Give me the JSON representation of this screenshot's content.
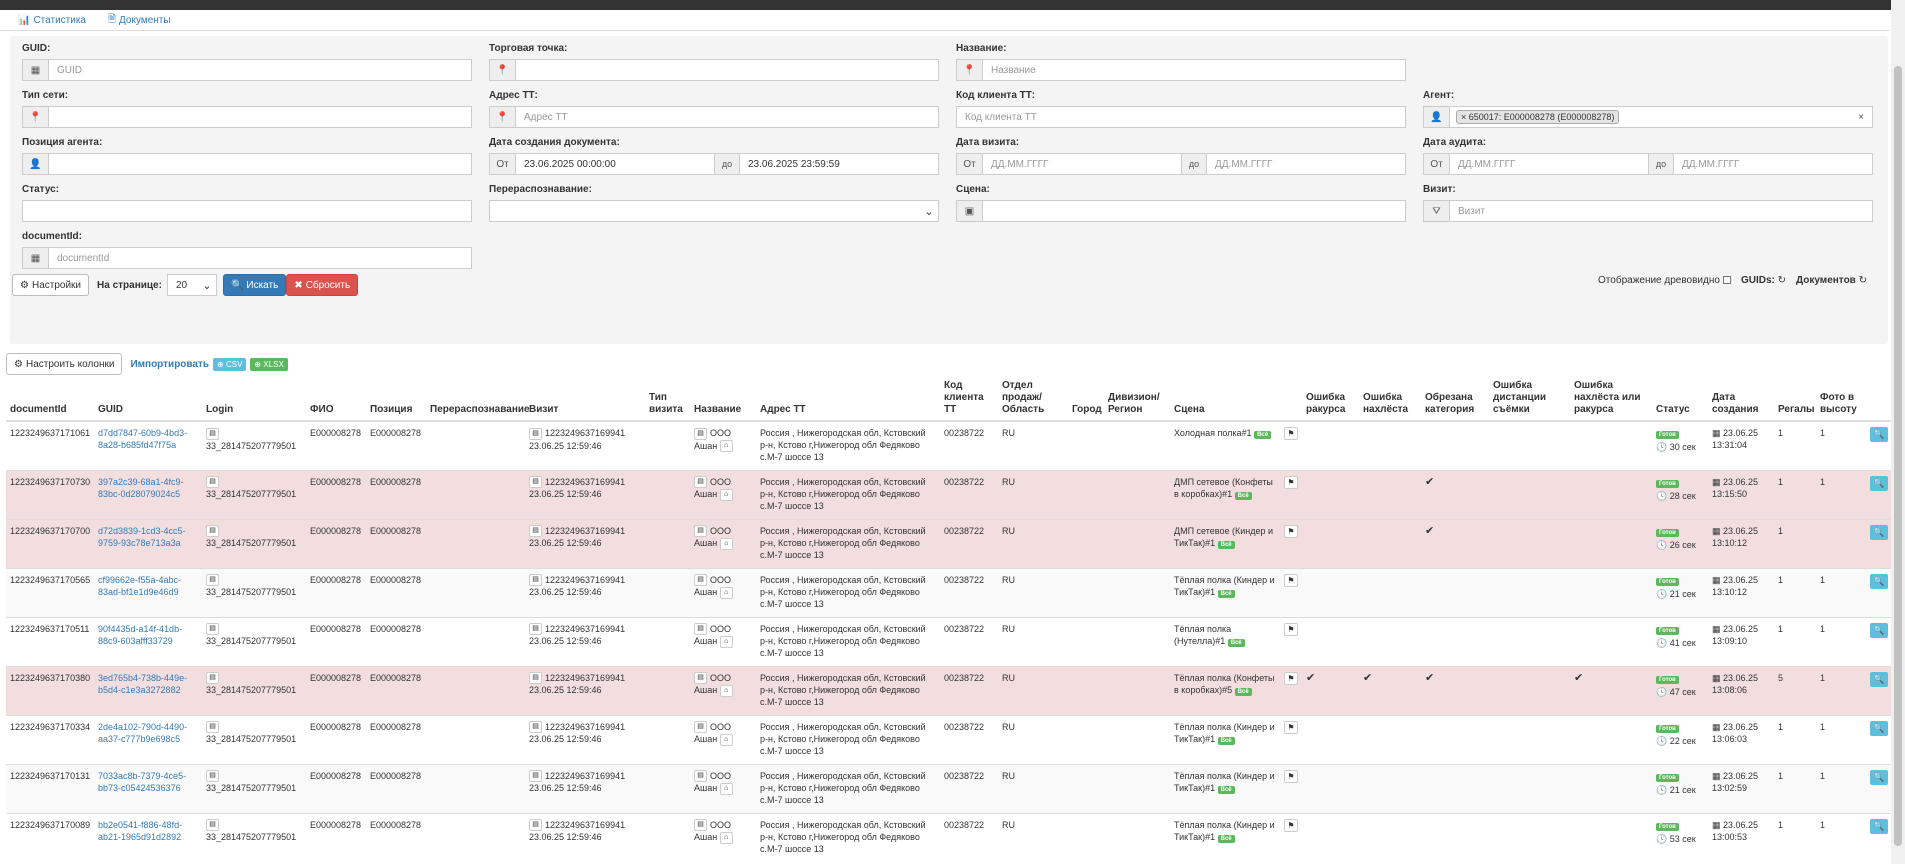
{
  "nav": {
    "stats": "Статистика",
    "docs": "Документы"
  },
  "filters": {
    "guid": {
      "label": "GUID:",
      "placeholder": "GUID"
    },
    "tradepoint": {
      "label": "Торговая точка:",
      "placeholder": ""
    },
    "name": {
      "label": "Название:",
      "placeholder": "Название"
    },
    "network_type": {
      "label": "Тип сети:",
      "placeholder": ""
    },
    "address": {
      "label": "Адрес ТТ:",
      "placeholder": "Адрес ТТ"
    },
    "client_code": {
      "label": "Код клиента ТТ:",
      "placeholder": "Код клиента ТТ"
    },
    "agent": {
      "label": "Агент:",
      "tag": "× 650017: E000008278 (E000008278)",
      "clear": "×"
    },
    "agent_position": {
      "label": "Позиция агента:",
      "placeholder": ""
    },
    "doc_date": {
      "label": "Дата создания документа:",
      "from_label": "От",
      "from": "23.06.2025 00:00:00",
      "to_label": "до",
      "to": "23.06.2025 23:59:59"
    },
    "visit_date": {
      "label": "Дата визита:",
      "from_label": "От",
      "from_ph": "ДД.ММ.ГГГГ",
      "to_label": "до",
      "to_ph": "ДД.ММ.ГГГГ"
    },
    "audit_date": {
      "label": "Дата аудита:",
      "from_label": "От",
      "from_ph": "ДД.ММ.ГГГГ",
      "to_label": "до",
      "to_ph": "ДД.ММ.ГГГГ"
    },
    "status": {
      "label": "Статус:"
    },
    "rerecog": {
      "label": "Перераспознавание:"
    },
    "scene": {
      "label": "Сцена:"
    },
    "visit": {
      "label": "Визит:",
      "placeholder": "Визит"
    },
    "documentid": {
      "label": "documentId:",
      "placeholder": "documentId"
    }
  },
  "controls": {
    "settings": "Настройки",
    "per_page_label": "На странице:",
    "per_page": "20",
    "search": "Искать",
    "reset": "Сбросить",
    "tree_view": "Отображение древовидно",
    "guids": "GUIDs:",
    "docs": "Документов"
  },
  "tablebar": {
    "columns": "Настроить колонки",
    "import": "Импортировать",
    "csv": "CSV",
    "xlsx": "XLSX"
  },
  "columns": [
    "documentId",
    "GUID",
    "Login",
    "ФИО",
    "Позиция",
    "Перераспознавание",
    "Визит",
    "Тип визита",
    "Название",
    "Адрес ТТ",
    "Код клиента ТТ",
    "Отдел продаж/ Область",
    "Город",
    "Дивизион/ Регион",
    "Сцена",
    "",
    "Ошибка ракурса",
    "Ошибка нахлёста",
    "Обрезана категория",
    "Ошибка дистанции съёмки",
    "Ошибка нахлёста или ракурса",
    "Статус",
    "Дата создания",
    "Регалы",
    "Фото в высоту",
    ""
  ],
  "common": {
    "login": "33_281475207779501",
    "fio": "E000008278",
    "position": "E000008278",
    "visit": "1223249637169941",
    "visit_date": "23.06.25 12:59:46",
    "name_ooo": "ООО",
    "name_ashan": "Ашан",
    "address": "Россия , Нижегородская обл, Кстовский р-н, Кстово г,Нижегород обл Федяково с.М-7 шоссе 13",
    "client_code": "00238722",
    "region": "RU",
    "ok": "Готов",
    "ok_badge": "Всё",
    "check": "✔"
  },
  "rows": [
    {
      "id": "1223249637171061",
      "guid": "d7dd7847-60b9-4bd3-8a28-b685fd47f75a",
      "scene": "Холодная полка#1",
      "e1": "",
      "e2": "",
      "e3": "",
      "e4": "",
      "e5": "",
      "age": "30 сек",
      "date": "23.06.25",
      "time": "13:31:04",
      "regals": "1",
      "photos": "1",
      "err": false
    },
    {
      "id": "1223249637170730",
      "guid": "397a2c39-68a1-4fc9-83bc-0d28079024c5",
      "scene": "ДМП сетевое (Конфеты в коробках)#1",
      "e1": "",
      "e2": "",
      "e3": "✔",
      "e4": "",
      "e5": "",
      "age": "28 сек",
      "date": "23.06.25",
      "time": "13:15:50",
      "regals": "1",
      "photos": "1",
      "err": true
    },
    {
      "id": "1223249637170700",
      "guid": "d72d3839-1cd3-4cc5-9759-93c78e713a3a",
      "scene": "ДМП сетевое (Киндер и ТикТак)#1",
      "e1": "",
      "e2": "",
      "e3": "✔",
      "e4": "",
      "e5": "",
      "age": "26 сек",
      "date": "23.06.25",
      "time": "13:10:12",
      "regals": "1",
      "photos": "",
      "err": true
    },
    {
      "id": "1223249637170565",
      "guid": "cf99662e-f55a-4abc-83ad-bf1e1d9e46d9",
      "scene": "Тёплая полка (Киндер и ТикТак)#1",
      "e1": "",
      "e2": "",
      "e3": "",
      "e4": "",
      "e5": "",
      "age": "21 сек",
      "date": "23.06.25",
      "time": "13:10:12",
      "regals": "1",
      "photos": "1",
      "err": false
    },
    {
      "id": "1223249637170511",
      "guid": "90f4435d-a14f-41db-88c9-603afff33729",
      "scene": "Тёплая полка (Нутелла)#1",
      "e1": "",
      "e2": "",
      "e3": "",
      "e4": "",
      "e5": "",
      "age": "41 сек",
      "date": "23.06.25",
      "time": "13:09:10",
      "regals": "1",
      "photos": "1",
      "err": false
    },
    {
      "id": "1223249637170380",
      "guid": "3ed765b4-738b-449e-b5d4-c1e3a3272882",
      "scene": "Тёплая полка (Конфеты в коробках)#5",
      "e1": "✔",
      "e2": "✔",
      "e3": "✔",
      "e4": "",
      "e5": "✔",
      "age": "47 сек",
      "date": "23.06.25",
      "time": "13:08:06",
      "regals": "5",
      "photos": "1",
      "err": true
    },
    {
      "id": "1223249637170334",
      "guid": "2de4a102-790d-4490-aa37-c777b9e698c5",
      "scene": "Тёплая полка (Киндер и ТикТак)#1",
      "e1": "",
      "e2": "",
      "e3": "",
      "e4": "",
      "e5": "",
      "age": "22 сек",
      "date": "23.06.25",
      "time": "13:06:03",
      "regals": "1",
      "photos": "1",
      "err": false
    },
    {
      "id": "1223249637170131",
      "guid": "7033ac8b-7379-4ce5-bb73-c05424536376",
      "scene": "Тёплая полка (Киндер и ТикТак)#1",
      "e1": "",
      "e2": "",
      "e3": "",
      "e4": "",
      "e5": "",
      "age": "21 сек",
      "date": "23.06.25",
      "time": "13:02:59",
      "regals": "1",
      "photos": "1",
      "err": false
    },
    {
      "id": "1223249637170089",
      "guid": "bb2e0541-f886-48fd-ab21-1965d91d2892",
      "scene": "Тёплая полка (Киндер и ТикТак)#1",
      "e1": "",
      "e2": "",
      "e3": "",
      "e4": "",
      "e5": "",
      "age": "53 сек",
      "date": "23.06.25",
      "time": "13:00:53",
      "regals": "1",
      "photos": "1",
      "err": false
    }
  ]
}
